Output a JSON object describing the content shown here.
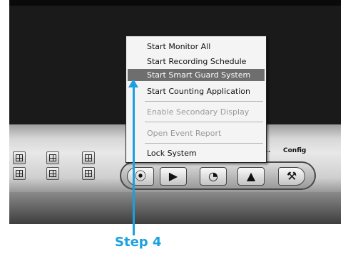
{
  "context_menu": {
    "items": [
      {
        "label": "Start Monitor All",
        "enabled": true,
        "highlighted": false
      },
      {
        "label": "Start Recording Schedule",
        "enabled": true,
        "highlighted": false
      },
      {
        "label": "Start Smart Guard System",
        "enabled": true,
        "highlighted": true
      },
      {
        "label": "Start Counting Application",
        "enabled": true,
        "highlighted": false
      },
      {
        "label": "Enable Secondary Display",
        "enabled": false,
        "highlighted": false
      },
      {
        "label": "Open Event Report",
        "enabled": false,
        "highlighted": false
      },
      {
        "label": "Lock System",
        "enabled": true,
        "highlighted": false
      }
    ]
  },
  "control_panel": {
    "config_label": "Config",
    "buttons": [
      {
        "icon": "record-icon",
        "glyph": "⦿"
      },
      {
        "icon": "playback-icon",
        "glyph": "▶"
      },
      {
        "icon": "schedule-icon",
        "glyph": "◔"
      },
      {
        "icon": "warning-icon",
        "glyph": "▲"
      },
      {
        "icon": "config-tool-icon",
        "glyph": "⚒"
      }
    ],
    "layout_button_icons": [
      "single-grid-icon",
      "quad-grid-icon",
      "nine-grid-icon",
      "sixteen-grid-icon",
      "rotate-icon",
      "fullscreen-icon"
    ]
  },
  "annotation": {
    "step_label": "Step 4",
    "color": "#1aa0e0"
  }
}
